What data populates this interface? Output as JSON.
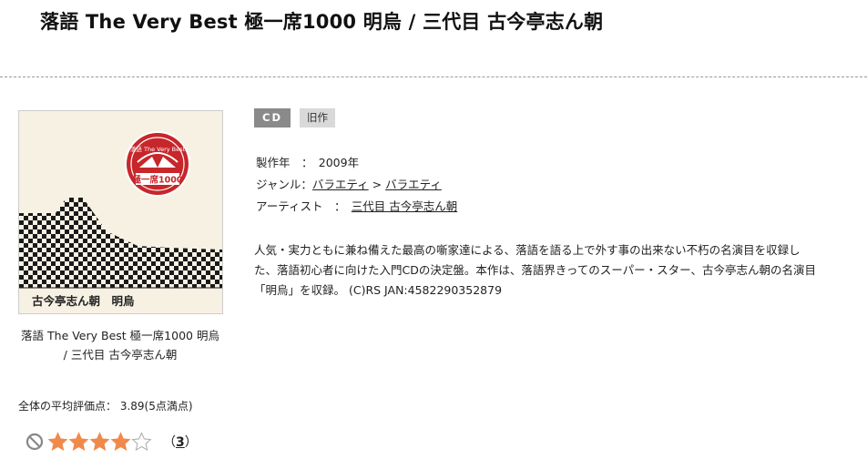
{
  "title": "落語 The Very Best 極一席1000 明烏 / 三代目 古今亭志ん朝",
  "cover": {
    "badge_top_text": "落語 The Very Best",
    "badge_main_text": "極一席1000",
    "footer_text": "古今亭志ん朝　明烏",
    "colors": {
      "badge_red": "#c7262a",
      "checker": "#1a1a1a",
      "background": "#f7f1e4"
    }
  },
  "caption": {
    "line1": "落語 The Very Best 極一席1000 明烏",
    "line2": "/ 三代目 古今亭志ん朝"
  },
  "badges": {
    "format": "CD",
    "category": "旧作"
  },
  "info": {
    "year_label": "製作年　：　",
    "year_value": "2009年",
    "genre_label": "ジャンル：",
    "genre_1": "バラエティ",
    "genre_sep": " > ",
    "genre_2": "バラエティ",
    "artist_label": "アーティスト　：　",
    "artist_value": "三代目 古今亭志ん朝"
  },
  "description": {
    "line1": "人気・実力ともに兼ね備えた最高の噺家達による、落語を語る上で外す事の出来ない不朽の名演目を収録し",
    "line2": "た、落語初心者に向けた入門CDの決定盤。本作は、落語界きってのスーパー・スター、古今亭志ん朝の名演目",
    "line3": "「明烏」を収録。 (C)RS JAN:4582290352879"
  },
  "rating": {
    "label": "全体の平均評価点：  3.89(5点満点)",
    "stars_filled": 4,
    "stars_total": 5,
    "count_open": "（",
    "count": "3",
    "count_close": "）",
    "colors": {
      "star_fill": "#f08a4b",
      "star_empty": "#ffffff",
      "star_stroke": "#aaaaaa",
      "no_icon": "#888888"
    }
  }
}
